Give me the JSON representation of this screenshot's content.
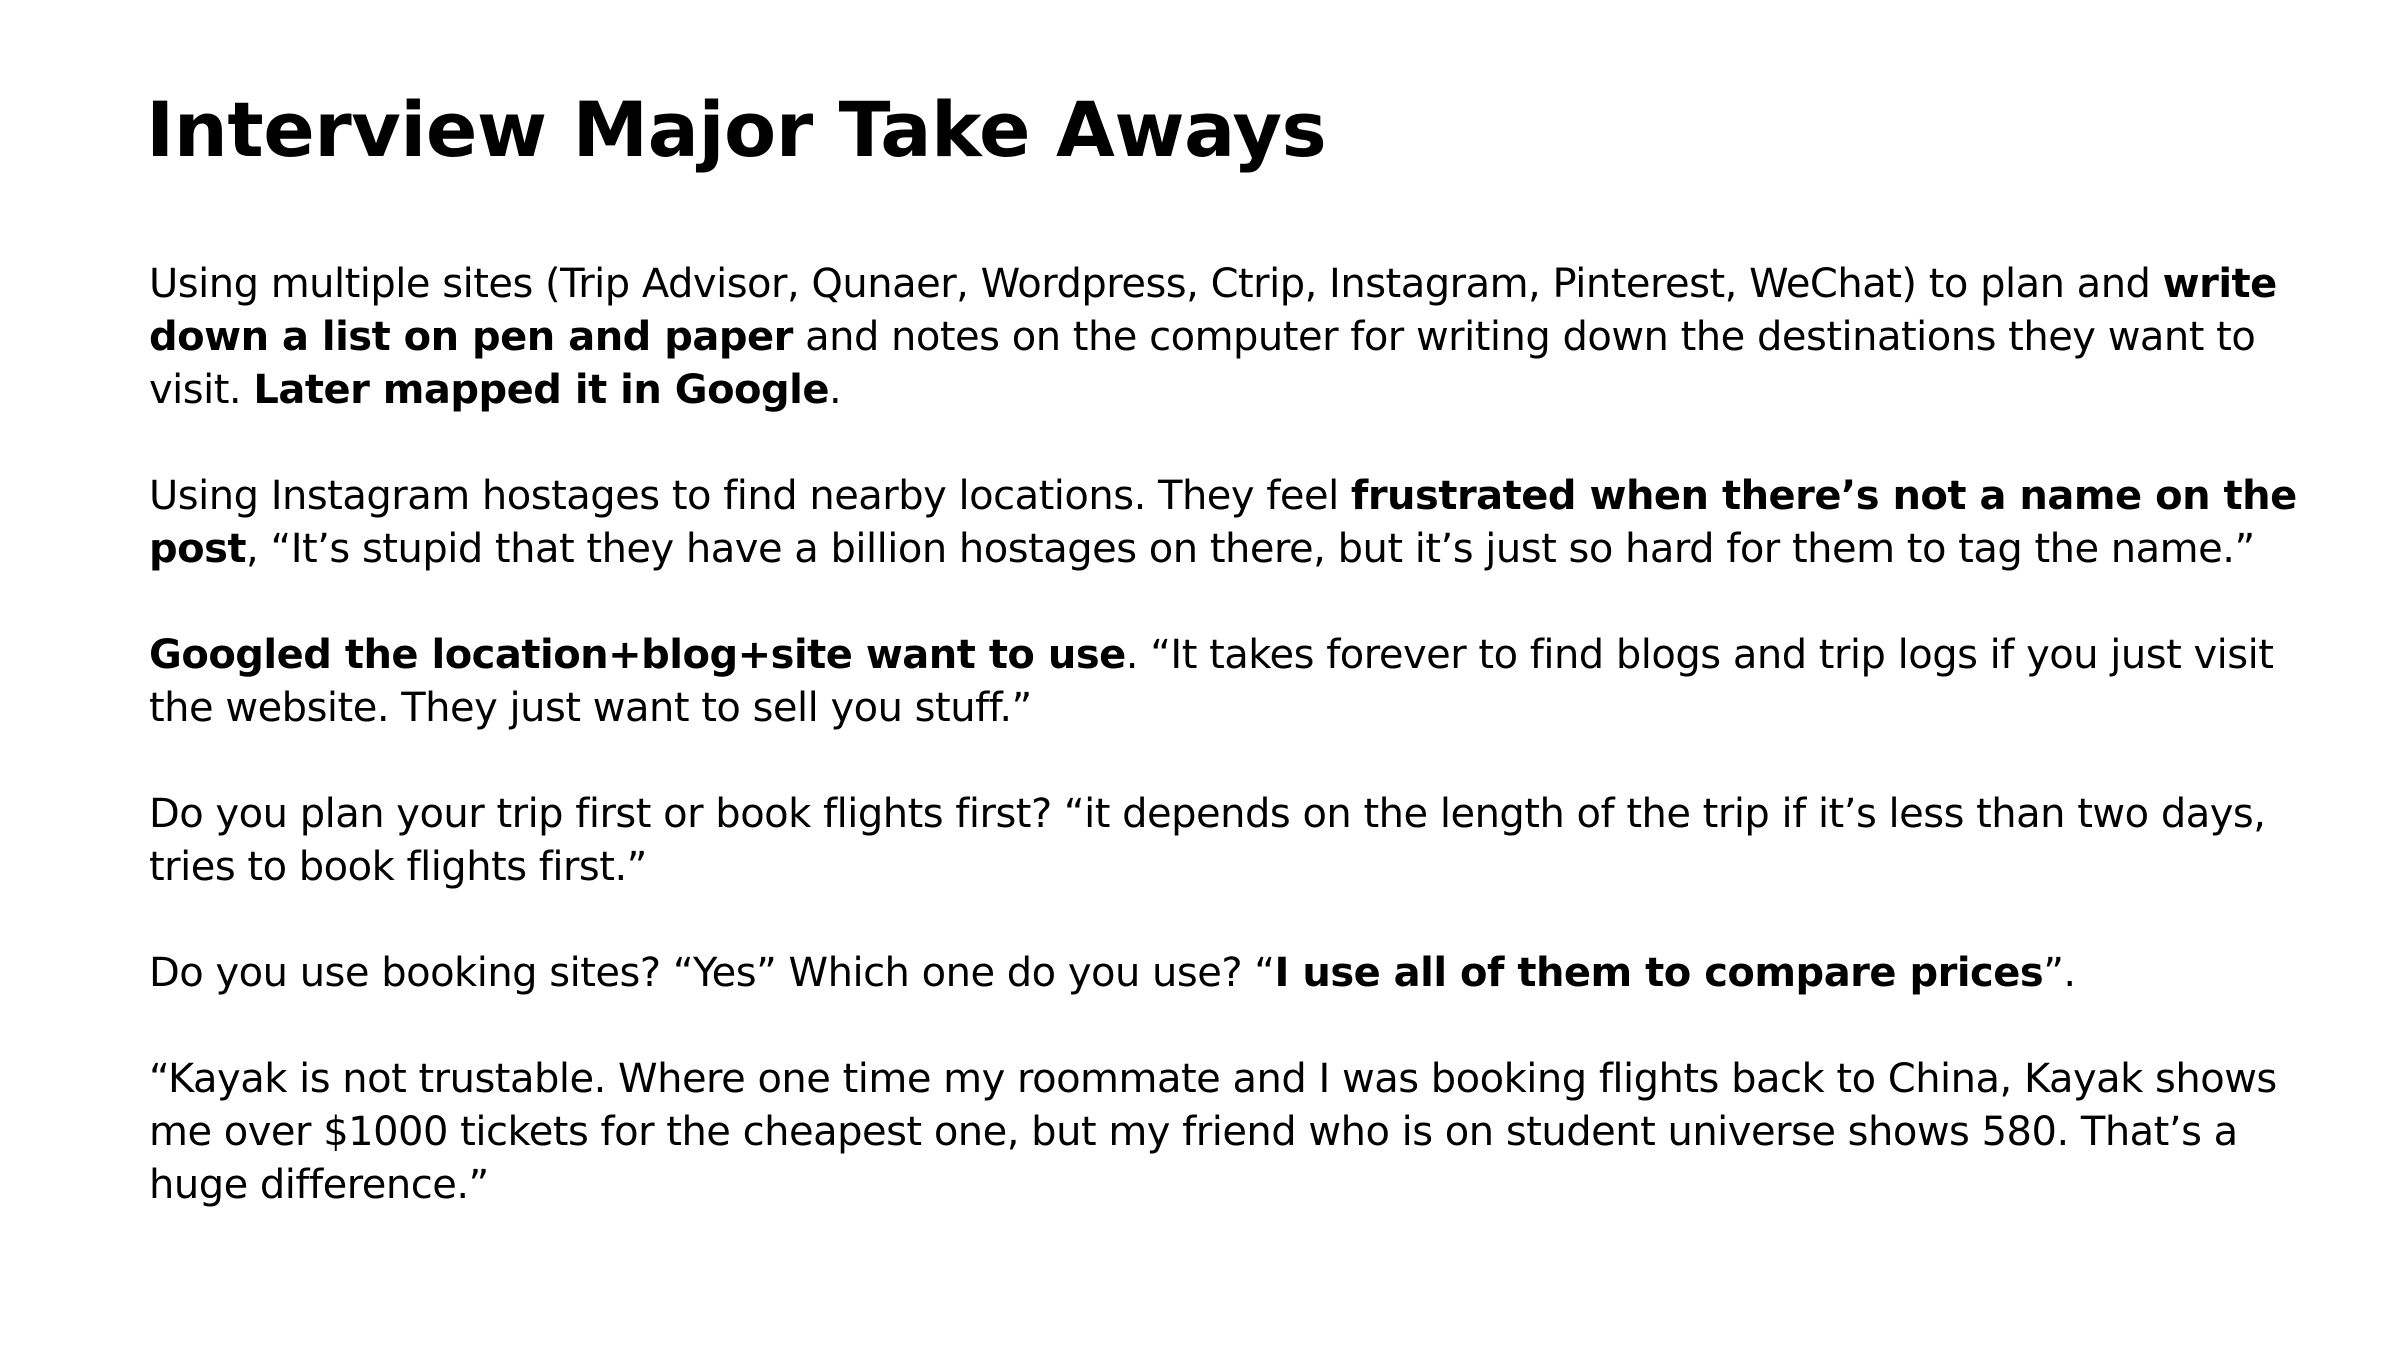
{
  "slide": {
    "title": "Interview Major Take Aways",
    "paragraphs": [
      {
        "segments": [
          {
            "text": "Using multiple sites (Trip Advisor, Qunaer, Wordpress, Ctrip, Instagram, Pinterest, WeChat) to plan and ",
            "bold": false
          },
          {
            "text": "write down a list on pen and paper",
            "bold": true
          },
          {
            "text": " and notes on the computer for writing down the destinations they want to visit. ",
            "bold": false
          },
          {
            "text": "Later mapped it in Google",
            "bold": true
          },
          {
            "text": ".",
            "bold": false
          }
        ]
      },
      {
        "segments": [
          {
            "text": "Using Instagram hostages to find nearby locations. They feel ",
            "bold": false
          },
          {
            "text": "frustrated when there’s not a name on the post",
            "bold": true
          },
          {
            "text": ", “It’s stupid that they have a billion hostages on there, but it’s just so hard for them to tag the name.”",
            "bold": false
          }
        ]
      },
      {
        "segments": [
          {
            "text": "Googled the location+blog+site want to use",
            "bold": true
          },
          {
            "text": ". “It takes forever to find blogs and trip logs if you just visit the website. They just want to sell you stuff.”",
            "bold": false
          }
        ]
      },
      {
        "segments": [
          {
            "text": "Do you plan your trip first or book flights first?  “it depends on the length of the trip if it’s less than two days, tries to book flights first.”",
            "bold": false
          }
        ]
      },
      {
        "segments": [
          {
            "text": "Do you use booking sites? “Yes” Which one do you use? “",
            "bold": false
          },
          {
            "text": "I use all of them to compare prices",
            "bold": true
          },
          {
            "text": "”.",
            "bold": false
          }
        ]
      },
      {
        "segments": [
          {
            "text": "“Kayak is not trustable. Where one time my roommate and I was booking flights back to China, Kayak shows me over $1000 tickets for the cheapest one, but my friend who is on student universe shows 580. That’s a huge difference.”",
            "bold": false
          }
        ]
      }
    ]
  }
}
